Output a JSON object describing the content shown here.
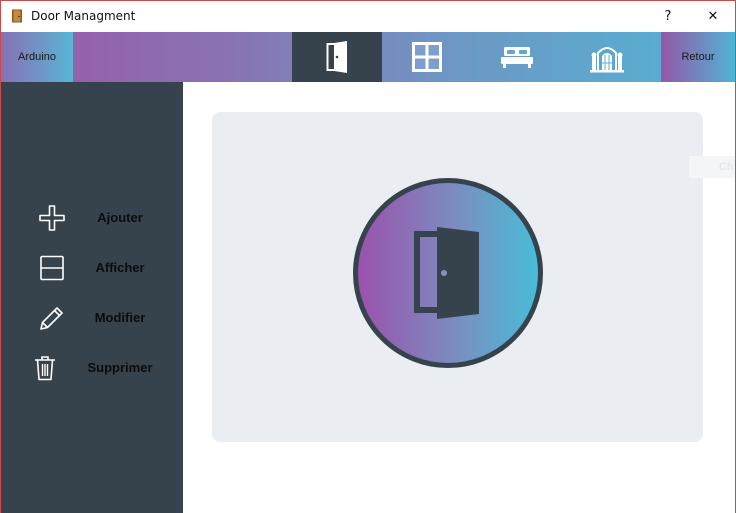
{
  "window": {
    "title": "Door Managment",
    "help_label": "?",
    "close_label": "✕"
  },
  "topnav": {
    "left_label": "Arduino",
    "right_label": "Retour",
    "tabs": [
      {
        "icon": "door-icon",
        "active": true
      },
      {
        "icon": "window-icon",
        "active": false
      },
      {
        "icon": "bed-icon",
        "active": false
      },
      {
        "icon": "house-icon",
        "active": false
      }
    ],
    "gradient_start": "#9a58aa",
    "gradient_end": "#52b4d4",
    "active_tab_color": "#36434c"
  },
  "sidebar": {
    "items": [
      {
        "icon": "plus-icon",
        "label": "Ajouter"
      },
      {
        "icon": "list-icon",
        "label": "Afficher"
      },
      {
        "icon": "pencil-icon",
        "label": "Modifier"
      },
      {
        "icon": "trash-icon",
        "label": "Supprimer"
      }
    ],
    "background": "#36434c"
  },
  "main": {
    "hero_icon": "door-icon",
    "ghost_text": "Ch"
  }
}
